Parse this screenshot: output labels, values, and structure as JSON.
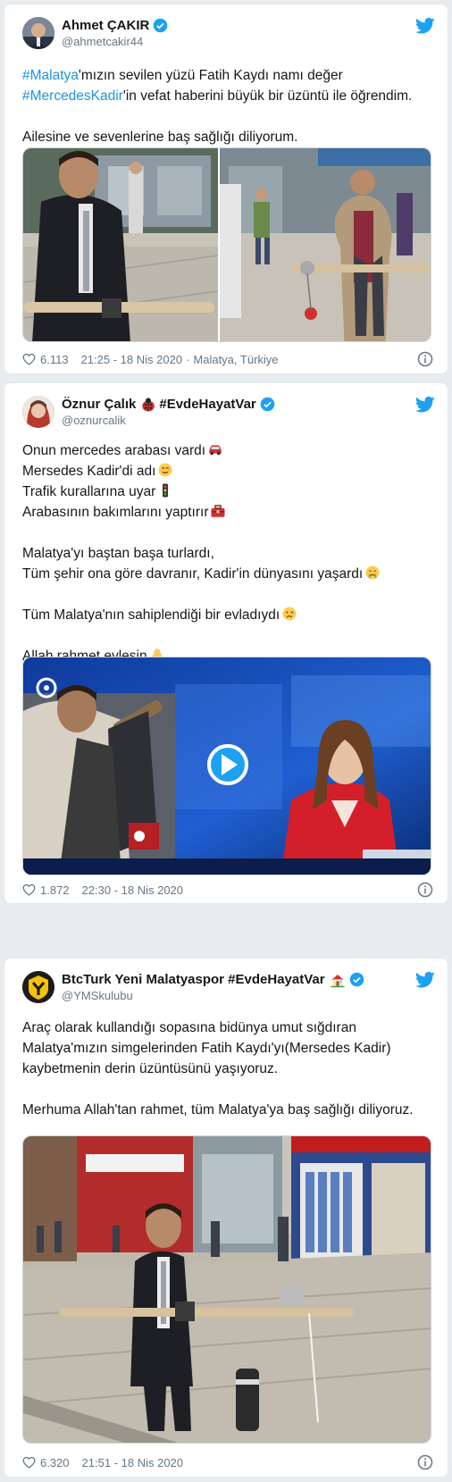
{
  "tweets": [
    {
      "display_name": "Ahmet ÇAKIR",
      "handle": "@ahmetcakir44",
      "line1_tag": "#Malatya",
      "line1_rest": "'mızın sevilen yüzü Fatih Kaydı namı değer",
      "line2_tag": "#MercedesKadir",
      "line2_rest": "'in vefat haberini büyük bir üzüntü ile öğrendim.",
      "line3": "Ailesine ve sevenlerine baş sağlığı diliyorum.",
      "likes": "6.113",
      "time": "21:25 - 18 Nis 2020",
      "location": "Malatya, Türkiye"
    },
    {
      "display_name": "Öznur Çalık",
      "display_tag": "#EvdeHayatVar",
      "handle": "@oznurcalik",
      "lines": [
        "Onun mercedes arabası vardı",
        "Mersedes Kadir'di adı",
        "Trafik kurallarına uyar",
        "Arabasının bakımlarını yaptırır",
        "Malatya'yı baştan başa turlardı,",
        "Tüm şehir ona göre davranır, Kadir'in dünyasını yaşardı",
        "Tüm Malatya'nın sahiplendiği bir evladıydı",
        "Allah rahmet eylesin"
      ],
      "likes": "1.872",
      "time": "22:30 - 18 Nis 2020"
    },
    {
      "display_name": "BtcTurk Yeni Malatyaspor #EvdeHayatVar",
      "handle": "@YMSkulubu",
      "lines": [
        "Araç olarak kullandığı sopasına bidünya umut sığdıran",
        "Malatya'mızın simgelerinden Fatih Kaydı'yı(Mersedes Kadir)",
        "kaybetmenin derin üzüntüsünü yaşıyoruz.",
        "Merhuma Allah'tan rahmet, tüm Malatya'ya baş sağlığı diliyoruz."
      ],
      "likes": "6.320",
      "time": "21:51 - 18 Nis 2020"
    }
  ],
  "colors": {
    "link": "#1b95e0",
    "muted": "#657786",
    "twitter_blue": "#1da1f2"
  },
  "icons": [
    "verified-badge-icon",
    "twitter-bird-icon",
    "heart-icon",
    "info-icon",
    "play-icon",
    "ladybug-emoji",
    "house-emoji",
    "car-emoji",
    "smile-emoji",
    "traffic-light-emoji",
    "toolbox-emoji",
    "crying-emoji",
    "sad-emoji",
    "praying-hands-emoji"
  ]
}
